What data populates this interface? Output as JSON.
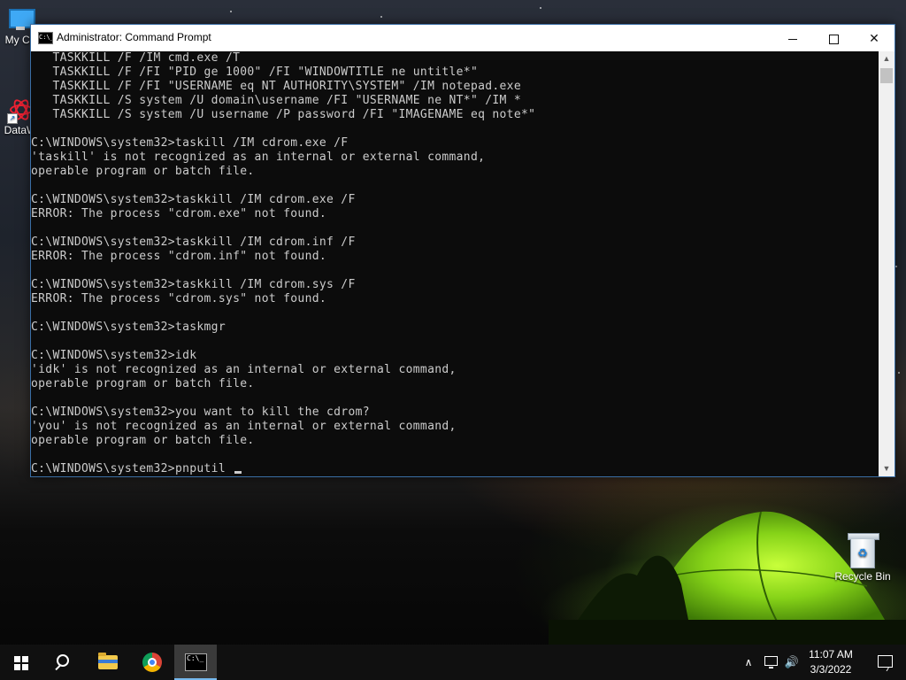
{
  "window": {
    "title": "Administrator: Command Prompt",
    "icon_text": "C:\\_"
  },
  "console": {
    "lines": [
      "   TASKKILL /F /IM cmd.exe /T",
      "   TASKKILL /F /FI \"PID ge 1000\" /FI \"WINDOWTITLE ne untitle*\"",
      "   TASKKILL /F /FI \"USERNAME eq NT AUTHORITY\\SYSTEM\" /IM notepad.exe",
      "   TASKKILL /S system /U domain\\username /FI \"USERNAME ne NT*\" /IM *",
      "   TASKKILL /S system /U username /P password /FI \"IMAGENAME eq note*\"",
      "",
      "C:\\WINDOWS\\system32>taskill /IM cdrom.exe /F",
      "'taskill' is not recognized as an internal or external command,",
      "operable program or batch file.",
      "",
      "C:\\WINDOWS\\system32>taskkill /IM cdrom.exe /F",
      "ERROR: The process \"cdrom.exe\" not found.",
      "",
      "C:\\WINDOWS\\system32>taskkill /IM cdrom.inf /F",
      "ERROR: The process \"cdrom.inf\" not found.",
      "",
      "C:\\WINDOWS\\system32>taskkill /IM cdrom.sys /F",
      "ERROR: The process \"cdrom.sys\" not found.",
      "",
      "C:\\WINDOWS\\system32>taskmgr",
      "",
      "C:\\WINDOWS\\system32>idk",
      "'idk' is not recognized as an internal or external command,",
      "operable program or batch file.",
      "",
      "C:\\WINDOWS\\system32>you want to kill the cdrom?",
      "'you' is not recognized as an internal or external command,",
      "operable program or batch file.",
      ""
    ],
    "current_prompt": "C:\\WINDOWS\\system32>",
    "current_input": "pnputil "
  },
  "desktop": {
    "icons": [
      {
        "label": "My Co",
        "icon": "computer-icon"
      },
      {
        "label": "DataW",
        "icon": "datawedge-icon"
      },
      {
        "label": "Recycle Bin",
        "icon": "recycle-bin-icon"
      }
    ]
  },
  "taskbar": {
    "apps": [
      "start-icon",
      "search-icon",
      "file-explorer-icon",
      "chrome-icon",
      "command-prompt-icon"
    ],
    "time": "11:07 AM",
    "date": "3/3/2022"
  },
  "colors": {
    "console_bg": "#0c0c0c",
    "console_fg": "#cccccc",
    "taskbar_bg": "#101010",
    "active_indicator": "#76b9ed"
  }
}
